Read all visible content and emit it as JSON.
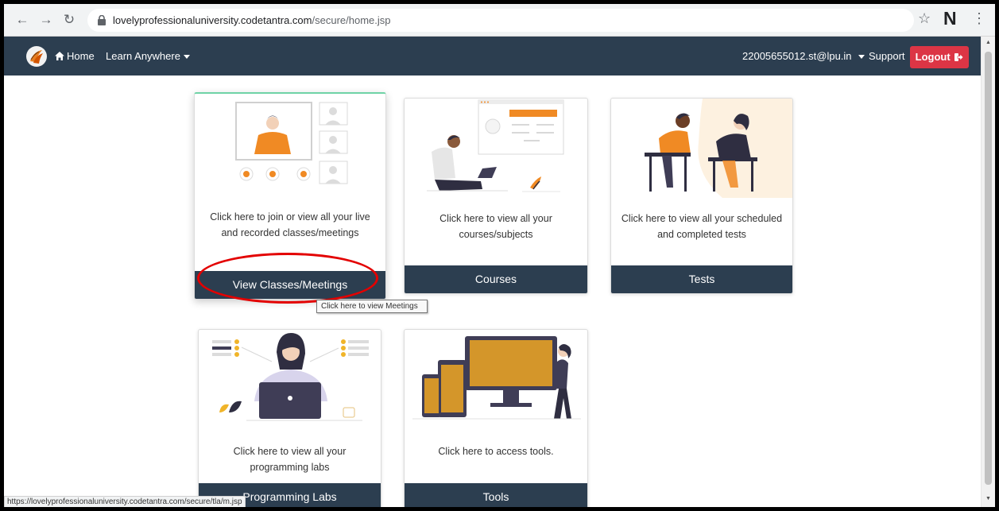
{
  "browser": {
    "url_host": "lovelyprofessionaluniversity.codetantra.com",
    "url_path": "/secure/home.jsp",
    "profile_initial": "N",
    "status_url": "https://lovelyprofessionaluniversity.codetantra.com/secure/tla/m.jsp"
  },
  "navbar": {
    "home_label": "Home",
    "learn_label": "Learn Anywhere",
    "user_label": "22005655012.st@lpu.in",
    "support_label": "Support",
    "logout_label": "Logout"
  },
  "cards": [
    {
      "desc": "Click here to join or view all your live and recorded classes/meetings",
      "button": "View Classes/Meetings"
    },
    {
      "desc": "Click here to view all your courses/subjects",
      "button": "Courses"
    },
    {
      "desc": "Click here to view all your scheduled and completed tests",
      "button": "Tests"
    },
    {
      "desc": "Click here to view all your programming labs",
      "button": "Programming Labs"
    },
    {
      "desc": "Click here to access tools.",
      "button": "Tools"
    }
  ],
  "tooltip": "Click here to view Meetings",
  "colors": {
    "navbar": "#2c3e50",
    "logout": "#dc3545",
    "accent_orange": "#f08a24",
    "accent_gold": "#d4962a"
  }
}
